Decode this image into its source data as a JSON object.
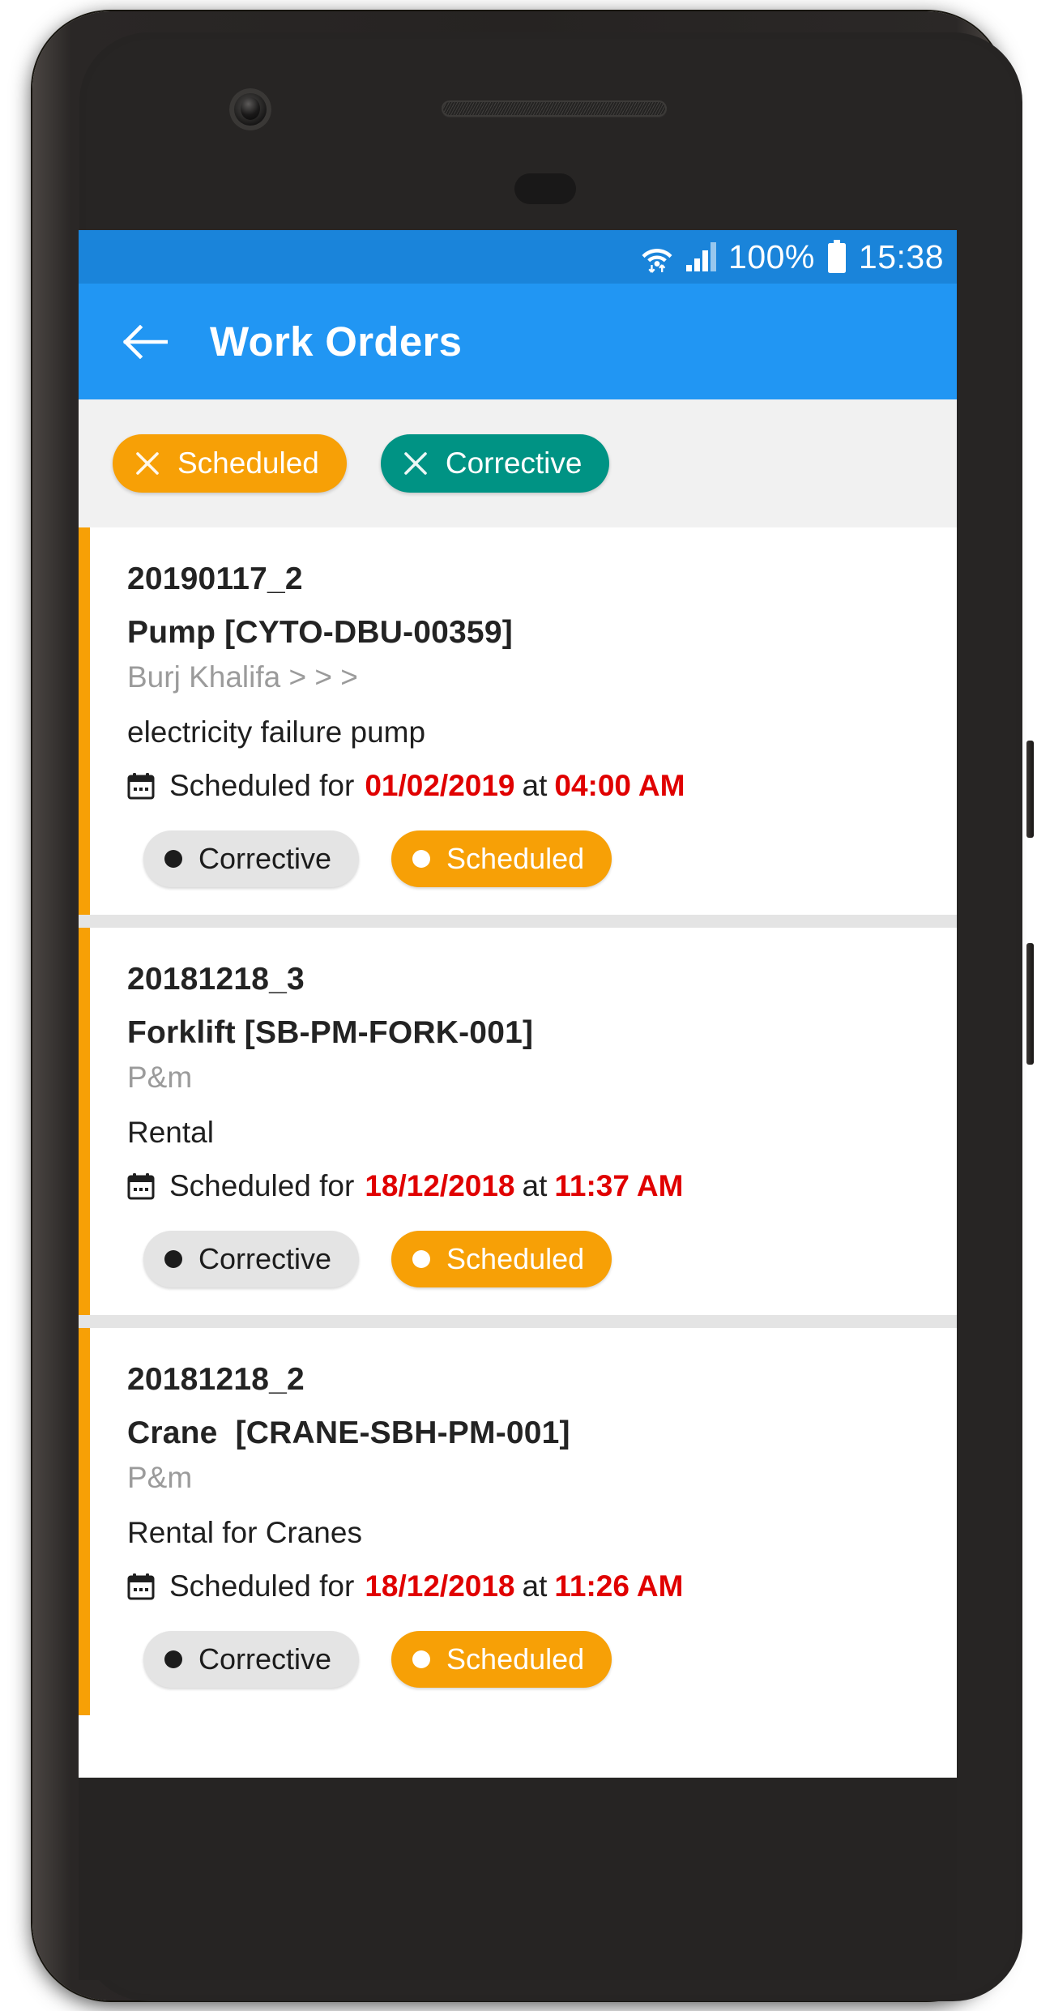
{
  "status_bar": {
    "wifi_icon": "wifi-icon",
    "signal_icon": "cellular-signal-icon",
    "battery_percent": "100%",
    "battery_icon": "battery-full-icon",
    "time": "15:38",
    "background_color": "#1a84da"
  },
  "app_bar": {
    "back_icon": "back-arrow-icon",
    "title": "Work Orders",
    "background_color": "#2196f3"
  },
  "filters": {
    "chips": [
      {
        "label": "Scheduled",
        "color": "#f7a006",
        "remove_icon": "close-x-icon"
      },
      {
        "label": "Corrective",
        "color": "#009384",
        "remove_icon": "close-x-icon"
      }
    ]
  },
  "work_orders": [
    {
      "code": "20190117_2",
      "asset": "Pump [CYTO-DBU-00359]",
      "location": "Burj Khalifa > > >",
      "description": "electricity failure pump",
      "schedule_label": "Scheduled for",
      "schedule_date": "01/02/2019",
      "schedule_at": "at",
      "schedule_time": "04:00 AM",
      "calendar_icon": "calendar-icon",
      "accent_color": "#f7a006",
      "badges": [
        {
          "label": "Corrective",
          "type": "inactive"
        },
        {
          "label": "Scheduled",
          "type": "active"
        }
      ]
    },
    {
      "code": "20181218_3",
      "asset": "Forklift [SB-PM-FORK-001]",
      "location": "P&m",
      "description": "Rental",
      "schedule_label": "Scheduled for",
      "schedule_date": "18/12/2018",
      "schedule_at": "at",
      "schedule_time": "11:37 AM",
      "calendar_icon": "calendar-icon",
      "accent_color": "#f7a006",
      "badges": [
        {
          "label": "Corrective",
          "type": "inactive"
        },
        {
          "label": "Scheduled",
          "type": "active"
        }
      ]
    },
    {
      "code": "20181218_2",
      "asset": "Crane  [CRANE-SBH-PM-001]",
      "location": "P&m",
      "description": "Rental for Cranes",
      "schedule_label": "Scheduled for",
      "schedule_date": "18/12/2018",
      "schedule_at": "at",
      "schedule_time": "11:26 AM",
      "calendar_icon": "calendar-icon",
      "accent_color": "#f7a006",
      "badges": [
        {
          "label": "Corrective",
          "type": "inactive"
        },
        {
          "label": "Scheduled",
          "type": "active"
        }
      ]
    }
  ]
}
